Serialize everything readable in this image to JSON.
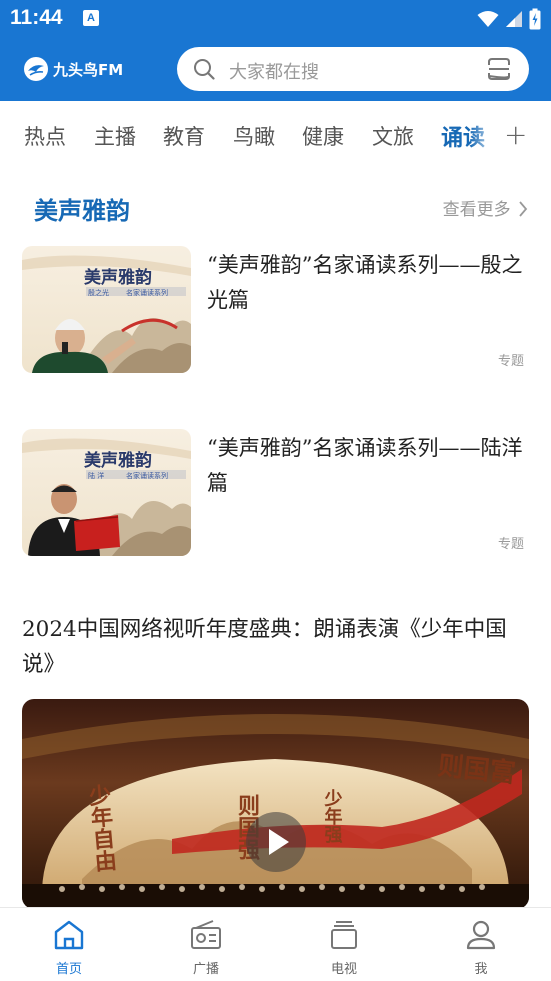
{
  "status_bar": {
    "time": "11:44",
    "app_icon_letter": "A"
  },
  "header": {
    "logo_text": "九头鸟FM",
    "search": {
      "placeholder": "大家都在搜"
    }
  },
  "tabs": [
    "热点",
    "主播",
    "教育",
    "鸟瞰",
    "健康",
    "文旅",
    "诵读"
  ],
  "active_tab_index": 6,
  "tab_add_icon": "plus-icon",
  "section": {
    "title": "美声雅韵",
    "more_label": "查看更多"
  },
  "items": [
    {
      "title": "“美声雅韵”名家诵读系列——殷之光篇",
      "tag": "专题",
      "thumb_heading": "美声雅韵",
      "thumb_sub_name": "殷之光",
      "thumb_sub_series": "名家诵读系列"
    },
    {
      "title": "“美声雅韵”名家诵读系列——陆洋篇",
      "tag": "专题",
      "thumb_heading": "美声雅韵",
      "thumb_sub_name": "陆 洋",
      "thumb_sub_series": "名家诵读系列"
    }
  ],
  "article": {
    "title": "2024中国网络视听年度盛典：朗诵表演《少年中国说》",
    "video_overlay_texts": [
      "少年自由",
      "则国强",
      "少年强",
      "则国富"
    ]
  },
  "bottom_nav": [
    {
      "label": "首页",
      "icon": "home-icon",
      "active": true
    },
    {
      "label": "广播",
      "icon": "radio-icon",
      "active": false
    },
    {
      "label": "电视",
      "icon": "tv-icon",
      "active": false
    },
    {
      "label": "我",
      "icon": "user-icon",
      "active": false
    }
  ],
  "colors": {
    "primary": "#1976d2",
    "accent_text": "#1769b5",
    "muted": "#999999"
  }
}
